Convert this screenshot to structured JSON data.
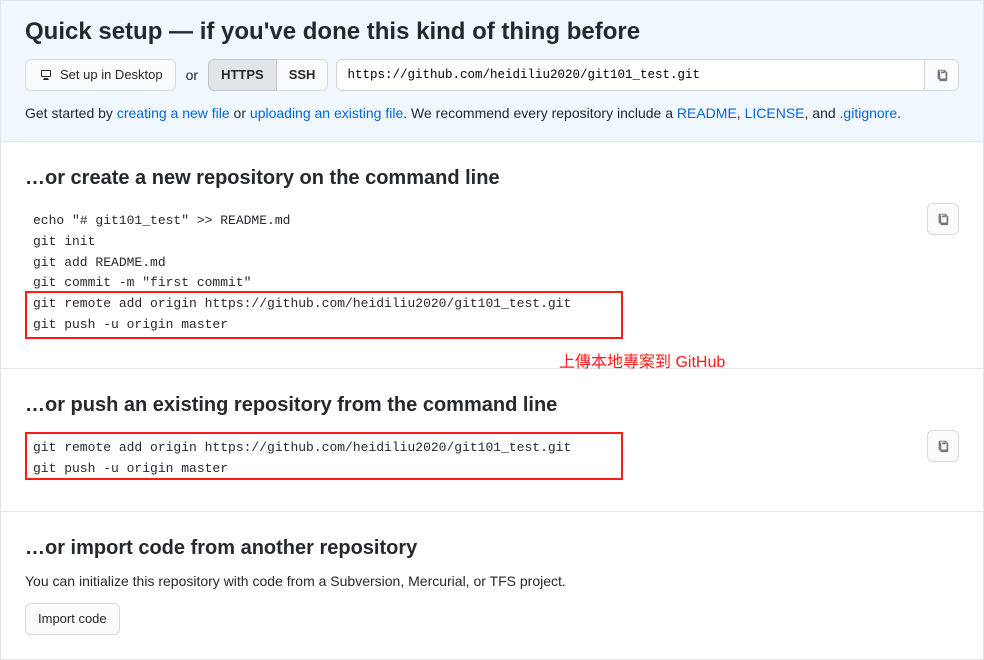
{
  "quick_setup": {
    "title": "Quick setup — if you've done this kind of thing before",
    "desktop_btn": "Set up in Desktop",
    "or": "or",
    "https": "HTTPS",
    "ssh": "SSH",
    "url": "https://github.com/heidiliu2020/git101_test.git",
    "get_started_1": "Get started by ",
    "link_new_file": "creating a new file",
    "get_started_2": " or ",
    "link_upload": "uploading an existing file",
    "get_started_3": ". We recommend every repository include a ",
    "link_readme": "README",
    "comma1": ", ",
    "link_license": "LICENSE",
    "comma2": ", and ",
    "link_gitignore": ".gitignore",
    "period": "."
  },
  "create_repo": {
    "title": "…or create a new repository on the command line",
    "code": "echo \"# git101_test\" >> README.md\ngit init\ngit add README.md\ngit commit -m \"first commit\"\ngit remote add origin https://github.com/heidiliu2020/git101_test.git\ngit push -u origin master"
  },
  "push_repo": {
    "title": "…or push an existing repository from the command line",
    "code": "git remote add origin https://github.com/heidiliu2020/git101_test.git\ngit push -u origin master"
  },
  "import_repo": {
    "title": "…or import code from another repository",
    "desc": "You can initialize this repository with code from a Subversion, Mercurial, or TFS project.",
    "btn": "Import code"
  },
  "annotation": "上傳本地專案到 GitHub"
}
